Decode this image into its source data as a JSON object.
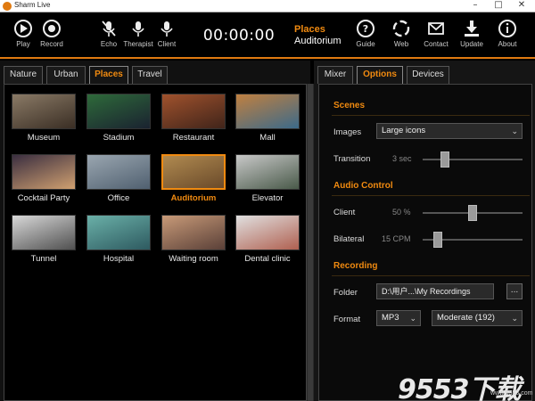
{
  "window": {
    "title": "Sharm Live",
    "minimize": "–",
    "maximize": "□",
    "close": "✕"
  },
  "toolbar": {
    "items": [
      {
        "label": "Play",
        "icon": "play-icon"
      },
      {
        "label": "Record",
        "icon": "record-icon"
      },
      {
        "label": "Echo",
        "icon": "mic-muted-icon"
      },
      {
        "label": "Therapist",
        "icon": "mic-icon"
      },
      {
        "label": "Client",
        "icon": "mic-icon"
      },
      {
        "label": "Guide",
        "icon": "help-icon"
      },
      {
        "label": "Web",
        "icon": "web-icon"
      },
      {
        "label": "Contact",
        "icon": "mail-icon"
      },
      {
        "label": "Update",
        "icon": "download-icon"
      },
      {
        "label": "About",
        "icon": "info-icon"
      }
    ],
    "timer": "00:00:00",
    "current_category": "Places",
    "current_scene": "Auditorium"
  },
  "left": {
    "tabs": [
      "Nature",
      "Urban",
      "Places",
      "Travel"
    ],
    "active_tab": "Places",
    "scenes": [
      {
        "name": "Museum",
        "c1": "#8a7a66",
        "c2": "#3a2e24"
      },
      {
        "name": "Stadium",
        "c1": "#2e6a3a",
        "c2": "#1a2230"
      },
      {
        "name": "Restaurant",
        "c1": "#a0522d",
        "c2": "#40241a"
      },
      {
        "name": "Mall",
        "c1": "#c08040",
        "c2": "#3c6a8a"
      },
      {
        "name": "Cocktail Party",
        "c1": "#3a2e40",
        "c2": "#d0a070"
      },
      {
        "name": "Office",
        "c1": "#9aa6b0",
        "c2": "#506070"
      },
      {
        "name": "Auditorium",
        "c1": "#b08a50",
        "c2": "#6a4a2a"
      },
      {
        "name": "Elevator",
        "c1": "#c8c8c8",
        "c2": "#4a5a4a"
      },
      {
        "name": "Tunnel",
        "c1": "#d8d8d8",
        "c2": "#505050"
      },
      {
        "name": "Hospital",
        "c1": "#6ab0a8",
        "c2": "#2e5a60"
      },
      {
        "name": "Waiting room",
        "c1": "#c89a78",
        "c2": "#5a4038"
      },
      {
        "name": "Dental clinic",
        "c1": "#e0e0e0",
        "c2": "#b06050"
      }
    ],
    "selected_scene": "Auditorium"
  },
  "right": {
    "tabs": [
      "Mixer",
      "Options",
      "Devices"
    ],
    "active_tab": "Options",
    "scenes_section": {
      "title": "Scenes",
      "images_label": "Images",
      "images_value": "Large icons",
      "transition_label": "Transition",
      "transition_value": "3 sec",
      "transition_level": 0.2
    },
    "audio_section": {
      "title": "Audio Control",
      "client_label": "Client",
      "client_value": "50 %",
      "client_level": 0.5,
      "bilateral_label": "Bilateral",
      "bilateral_value": "15 CPM",
      "bilateral_level": 0.12
    },
    "recording_section": {
      "title": "Recording",
      "folder_label": "Folder",
      "folder_value": "D:\\用户...\\My Recordings",
      "browse_label": "...",
      "format_label": "Format",
      "format_value": "MP3",
      "quality_value": "Moderate (192)"
    }
  },
  "watermark": {
    "brand": "9553下载",
    "url": "www.9553.com"
  },
  "colors": {
    "accent": "#f08a10",
    "background": "#000000"
  }
}
